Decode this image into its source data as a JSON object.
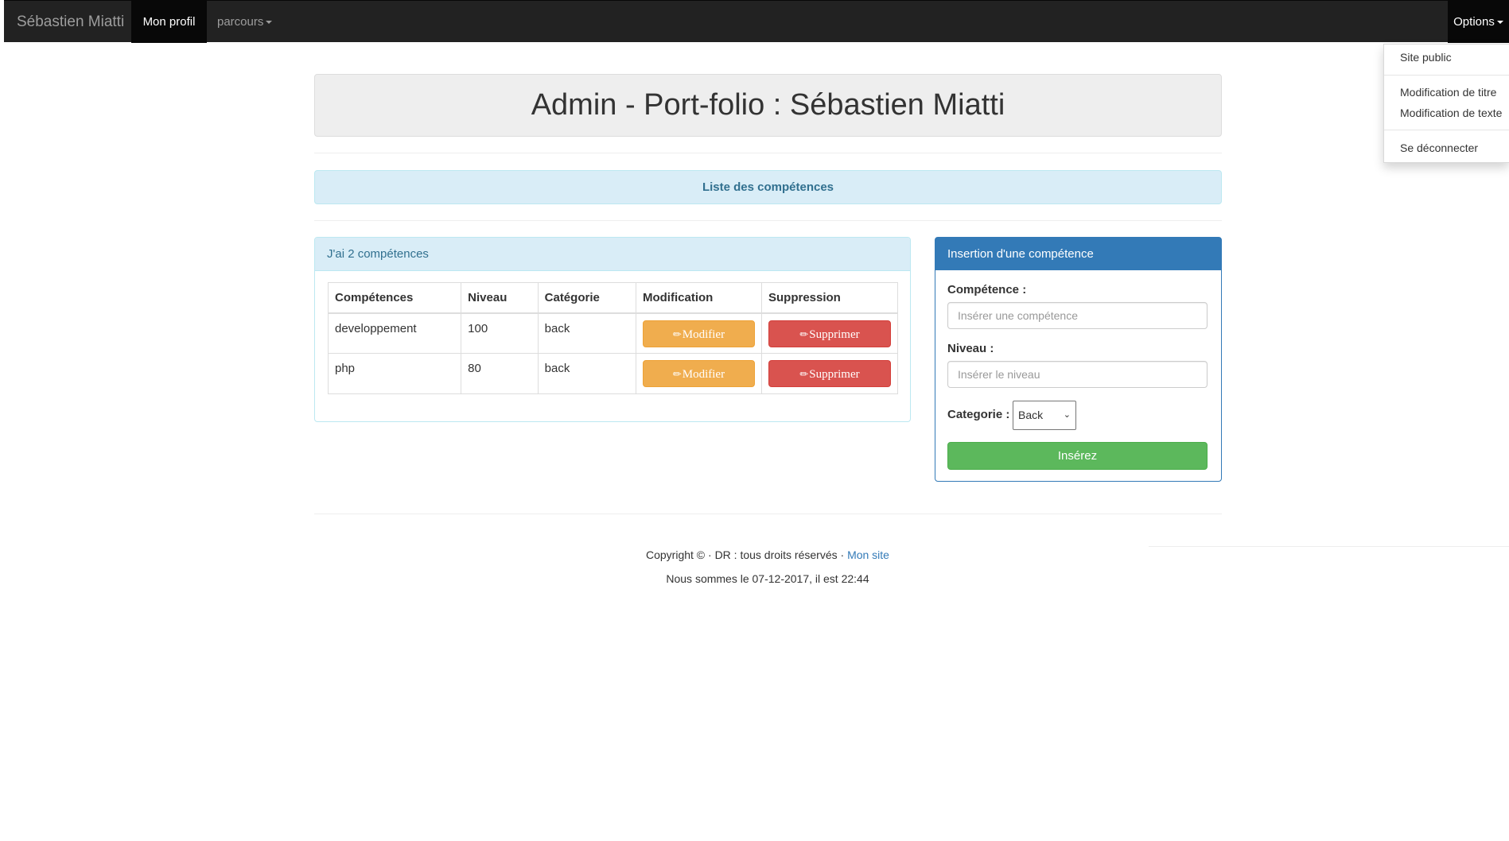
{
  "navbar": {
    "brand": "Sébastien Miatti",
    "items": [
      "Mon profil",
      "parcours"
    ],
    "options_label": "Options"
  },
  "dropdown": {
    "items": [
      "Site public",
      "Modification de titre",
      "Modification de texte",
      "Se déconnecter"
    ]
  },
  "header": {
    "title": "Admin - Port-folio : Sébastien Miatti"
  },
  "alert": {
    "text": "Liste des compétences"
  },
  "skills_panel": {
    "heading": "J'ai 2 compétences",
    "columns": [
      "Compétences",
      "Niveau",
      "Catégorie",
      "Modification",
      "Suppression"
    ],
    "rows": [
      {
        "competence": "developpement",
        "niveau": "100",
        "categorie": "back",
        "edit_label": "Modifier",
        "delete_label": "Supprimer"
      },
      {
        "competence": "php",
        "niveau": "80",
        "categorie": "back",
        "edit_label": "Modifier",
        "delete_label": "Supprimer"
      }
    ]
  },
  "insert_panel": {
    "heading": "Insertion d'une compétence",
    "competence_label": "Compétence :",
    "competence_placeholder": "Insérer une compétence",
    "niveau_label": "Niveau :",
    "niveau_placeholder": "Insérer le niveau",
    "categorie_label": "Categorie :",
    "categorie_selected": "Back",
    "submit_label": "Insérez"
  },
  "footer": {
    "copyright": "Copyright © · DR : tous droits réservés · ",
    "link": "Mon site",
    "date_line": "Nous sommes le 07-12-2017, il est 22:44"
  },
  "colors": {
    "navbar": "#222222",
    "primary": "#337ab7",
    "info_bg": "#d9edf7",
    "warning": "#f0ad4e",
    "danger": "#d9534f",
    "success": "#5cb85c"
  }
}
